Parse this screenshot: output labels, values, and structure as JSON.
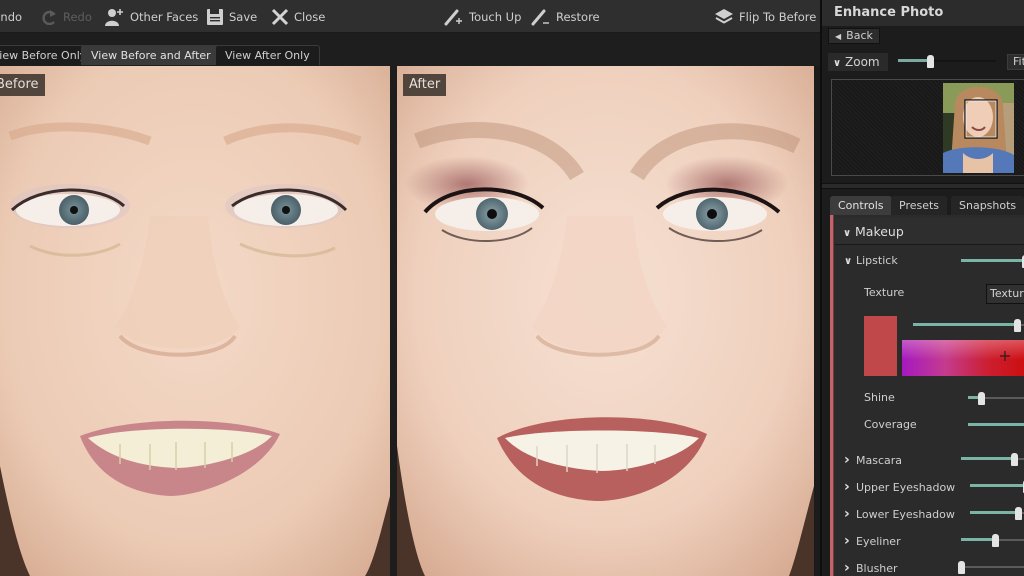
{
  "toolbar": {
    "undo": "Undo",
    "redo": "Redo",
    "other_faces": "Other Faces",
    "save": "Save",
    "close": "Close",
    "touch_up": "Touch Up",
    "restore": "Restore",
    "flip": "Flip To Before"
  },
  "view_tabs": [
    {
      "label": "View Before Only",
      "active": false
    },
    {
      "label": "View Before and After",
      "active": true
    },
    {
      "label": "View After Only",
      "active": false
    }
  ],
  "photos": {
    "before_label": "Before",
    "after_label": "After"
  },
  "panel": {
    "title": "Enhance Photo",
    "back": "Back",
    "zoom_label": "Zoom",
    "zoom_value": 0.33,
    "fit": "Fit",
    "tabs": [
      {
        "label": "Controls",
        "active": true
      },
      {
        "label": "Presets",
        "active": false
      },
      {
        "label": "Snapshots",
        "active": false
      }
    ],
    "section": "Makeup",
    "lipstick": {
      "label": "Lipstick",
      "amount": 0.98,
      "texture_label": "Texture",
      "texture_value": "Texture",
      "color_hex": "#c0484b",
      "color_intensity": 0.92,
      "shine_label": "Shine",
      "shine": 0.22,
      "coverage_label": "Coverage",
      "coverage": 1.0
    },
    "items": [
      {
        "label": "Mascara",
        "value": 0.82
      },
      {
        "label": "Upper Eyeshadow",
        "value": 1.0
      },
      {
        "label": "Lower Eyeshadow",
        "value": 0.85
      },
      {
        "label": "Eyeliner",
        "value": 0.53
      },
      {
        "label": "Blusher",
        "value": 0.0
      }
    ]
  },
  "colors": {
    "accent": "#c2656a",
    "slider_fill": "#79b4a4"
  }
}
